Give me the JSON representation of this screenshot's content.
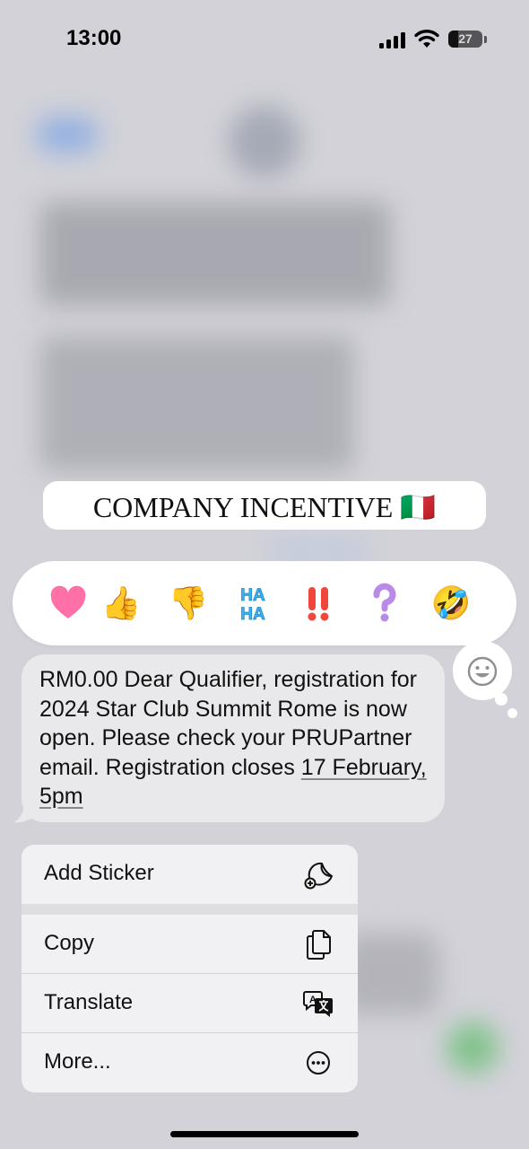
{
  "status_bar": {
    "time": "13:00",
    "battery_level": "27",
    "icons": [
      "cellular-signal-icon",
      "wifi-icon",
      "battery-icon"
    ]
  },
  "pinned_title": {
    "text": "COMPANY INCENTIVE 🇮🇹"
  },
  "reactions": [
    {
      "name": "heart",
      "glyph": "🩷"
    },
    {
      "name": "thumbs-up",
      "glyph": "👍"
    },
    {
      "name": "thumbs-down",
      "glyph": "👎"
    },
    {
      "name": "haha",
      "glyph": "HA HA"
    },
    {
      "name": "exclamation",
      "glyph": "‼️"
    },
    {
      "name": "question",
      "glyph": "❓"
    },
    {
      "name": "rolling-laughing",
      "glyph": "🤣"
    }
  ],
  "message": {
    "text_before_link": "RM0.00 Dear Qualifier, registration for 2024 Star Club Summit Rome is now open. Please check your PRUPartner email. Registration closes ",
    "link_text": "17 February, 5pm"
  },
  "context_menu": {
    "items": [
      {
        "label": "Add Sticker",
        "icon": "add-sticker-icon"
      },
      {
        "label": "Copy",
        "icon": "copy-icon"
      },
      {
        "label": "Translate",
        "icon": "translate-icon"
      },
      {
        "label": "More...",
        "icon": "more-icon"
      }
    ]
  },
  "colors": {
    "background": "#d2d2d8",
    "bubble": "#e9e9eb",
    "menu": "#f1f1f3",
    "heart": "#ff6fa8",
    "thumb": "#f5a623",
    "haha": "#3fb2f0",
    "exclaim": "#f0473a",
    "question": "#b98be8"
  }
}
